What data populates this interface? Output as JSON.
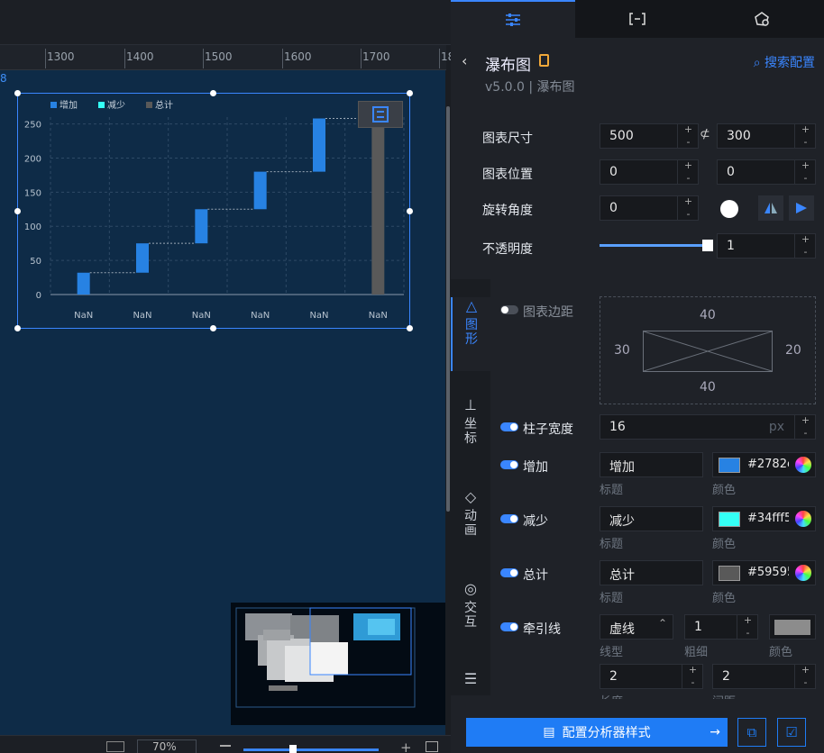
{
  "ruler": {
    "ticks": [
      "1300",
      "1400",
      "1500",
      "1600",
      "1700",
      "18"
    ]
  },
  "canvas": {
    "edge_label": "8",
    "zoom": "70%"
  },
  "chart_data": {
    "type": "bar",
    "categories": [
      "NaN",
      "NaN",
      "NaN",
      "NaN",
      "NaN",
      "NaN"
    ],
    "series": [
      {
        "name": "增加",
        "values": [
          [
            0,
            32
          ],
          [
            32,
            75
          ],
          [
            75,
            125
          ],
          [
            125,
            180
          ],
          [
            180,
            258
          ]
        ]
      },
      {
        "name": "减少",
        "values": []
      },
      {
        "name": "总计",
        "values": [
          [
            0,
            258
          ]
        ]
      }
    ],
    "legend": [
      "增加",
      "减少",
      "总计"
    ],
    "legend_colors": [
      "#2782e3",
      "#34fff5",
      "#595959"
    ],
    "yticks": [
      "0",
      "50",
      "100",
      "150",
      "200",
      "250"
    ],
    "ylim": [
      0,
      260
    ],
    "grid": true,
    "legend_position": "top-left"
  },
  "tabs": [
    "style-icon",
    "bracket-icon",
    "shape-icon"
  ],
  "panel": {
    "back": "‹",
    "title": "瀑布图",
    "version": "v5.0.0 | 瀑布图",
    "search": "搜索配置",
    "size_label": "图表尺寸",
    "width": "500",
    "height": "300",
    "position_label": "图表位置",
    "pos_x": "0",
    "pos_y": "0",
    "rotate_label": "旋转角度",
    "rotate": "0",
    "opacity_label": "不透明度",
    "opacity": "1",
    "margin_label": "图表边距",
    "margin": {
      "top": "40",
      "left": "30",
      "right": "20",
      "bottom": "40"
    },
    "bar_width_label": "柱子宽度",
    "bar_width": "16",
    "bar_width_unit": "px",
    "series": [
      {
        "label": "增加",
        "title": "增加",
        "color": "#2782e3",
        "color_text": "#2782e3"
      },
      {
        "label": "减少",
        "title": "减少",
        "color": "#34fff5",
        "color_text": "#34fff5"
      },
      {
        "label": "总计",
        "title": "总计",
        "color": "#595959",
        "color_text": "#595959"
      }
    ],
    "title_sub": "标题",
    "color_sub": "颜色",
    "leader_label": "牵引线",
    "leader_type": "虚线",
    "leader_width": "1",
    "leader_color": "#8c8c8c",
    "leader_sub_type": "线型",
    "leader_sub_width": "粗细",
    "leader_sub_color": "颜色",
    "dash_a": "2",
    "dash_b": "2",
    "dash_a_sub": "长度",
    "dash_b_sub": "间距",
    "side_tabs": [
      "图形",
      "坐标",
      "动画",
      "交互"
    ],
    "footer_button": "配置分析器样式"
  }
}
